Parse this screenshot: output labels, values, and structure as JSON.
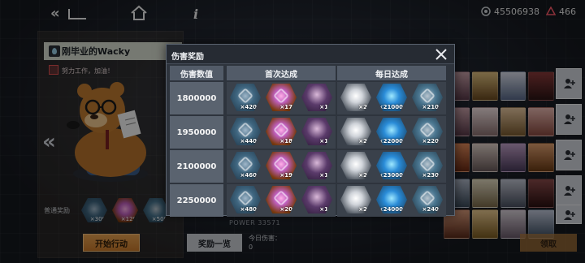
{
  "topbar": {
    "currency_1": "45506938",
    "currency_2": "466"
  },
  "left_panel": {
    "name": "刚毕业的Wacky",
    "motto": "努力工作，加油！",
    "normal_rewards_label": "普通奖励",
    "normal_rewards": [
      {
        "qty": "×300",
        "icon": "chip-icon"
      },
      {
        "qty": "×120",
        "icon": "orb-icon"
      },
      {
        "qty": "×500",
        "icon": "material-icon"
      }
    ],
    "start_button": "开始行动"
  },
  "footer": {
    "reward_list_button": "奖励一览",
    "today_damage_label": "今日伤害：",
    "today_damage_value": "0",
    "power_text": "POWER 33571",
    "receive_button": "领取"
  },
  "modal": {
    "title": "伤害奖励",
    "columns": {
      "damage": "伤害数值",
      "first": "首次达成",
      "daily": "每日达成"
    },
    "rows": [
      {
        "damage": "1800000",
        "first": [
          "×420",
          "×17",
          "×1"
        ],
        "daily": [
          "×2",
          "×21000",
          "×210"
        ]
      },
      {
        "damage": "1950000",
        "first": [
          "×440",
          "×18",
          "×1"
        ],
        "daily": [
          "×2",
          "×22000",
          "×220"
        ]
      },
      {
        "damage": "2100000",
        "first": [
          "×460",
          "×19",
          "×1"
        ],
        "daily": [
          "×2",
          "×23000",
          "×230"
        ]
      },
      {
        "damage": "2250000",
        "first": [
          "×480",
          "×20",
          "×1"
        ],
        "daily": [
          "×2",
          "×24000",
          "×240"
        ]
      }
    ]
  },
  "colors": {
    "accent_orange": "#e6a050",
    "modal_bg": "#2e343d",
    "header_cell": "#525b68"
  }
}
